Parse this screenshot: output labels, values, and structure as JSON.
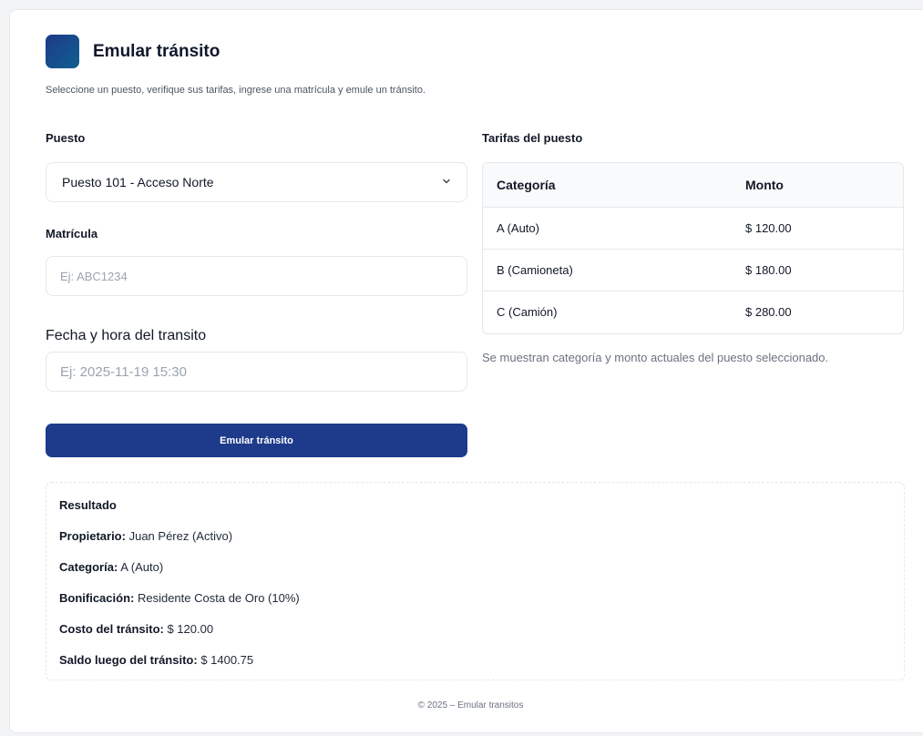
{
  "header": {
    "title": "Emular tránsito",
    "subtitle": "Seleccione un puesto, verifique sus tarifas, ingrese una matrícula y emule un tránsito."
  },
  "form": {
    "puesto_label": "Puesto",
    "puesto_selected": "Puesto 101 - Acceso Norte",
    "matricula_label": "Matrícula",
    "matricula_placeholder": "Ej: ABC1234",
    "fecha_label": "Fecha y hora del transito",
    "fecha_placeholder": "Ej: 2025-11-19 15:30",
    "submit_label": "Emular tránsito"
  },
  "tarifas": {
    "title": "Tarifas del puesto",
    "headers": [
      "Categoría",
      "Monto"
    ],
    "rows": [
      [
        "A (Auto)",
        "$ 120.00"
      ],
      [
        "B (Camioneta)",
        "$ 180.00"
      ],
      [
        "C (Camión)",
        "$ 280.00"
      ]
    ],
    "note": "Se muestran categoría y monto actuales del puesto seleccionado."
  },
  "resultado": {
    "title": "Resultado",
    "lines": [
      {
        "label": "Propietario:",
        "value": "Juan Pérez (Activo)"
      },
      {
        "label": "Categoría:",
        "value": "A (Auto)"
      },
      {
        "label": "Bonificación:",
        "value": "Residente Costa de Oro (10%)"
      },
      {
        "label": "Costo del tránsito:",
        "value": "$ 120.00"
      },
      {
        "label": "Saldo luego del tránsito:",
        "value": "$ 1400.75"
      }
    ]
  },
  "footer": "© 2025 – Emular transitos",
  "colors": {
    "primary": "#1e3a8a",
    "background": "#f3f4f6",
    "border": "#e5e7eb"
  },
  "icons": {
    "logo": "app-logo-icon",
    "select": "chevron-down-icon"
  }
}
